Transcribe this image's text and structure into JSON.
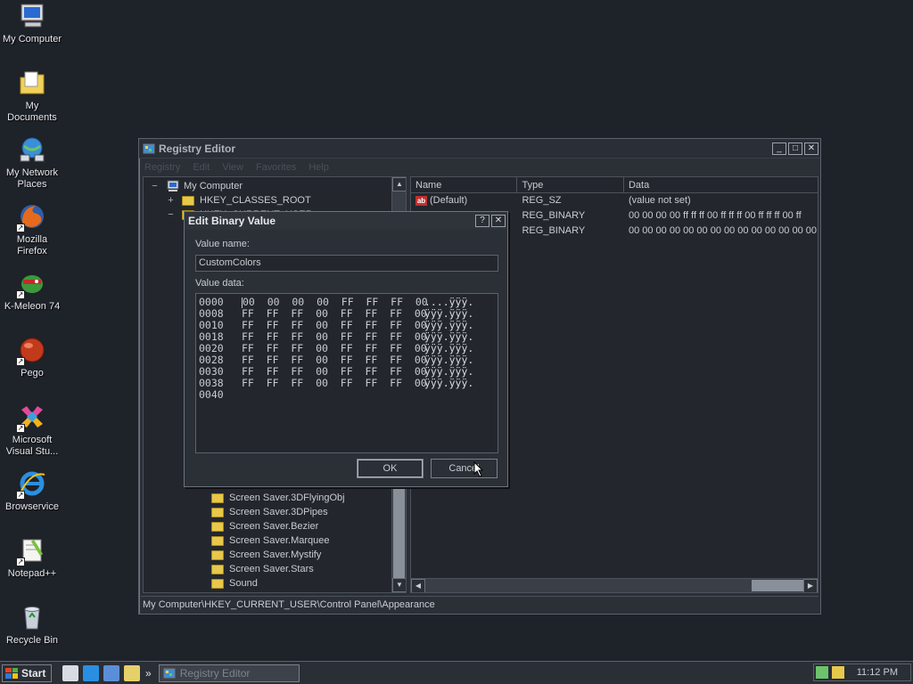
{
  "desktop": {
    "icons": [
      {
        "label": "My Computer",
        "icon": "computer-icon"
      },
      {
        "label": "My Documents",
        "icon": "documents-folder-icon"
      },
      {
        "label": "My Network Places",
        "icon": "network-icon"
      },
      {
        "label": "Mozilla Firefox",
        "icon": "firefox-icon"
      },
      {
        "label": "K-Meleon 74",
        "icon": "k-meleon-icon"
      },
      {
        "label": "Pego",
        "icon": "pego-icon"
      },
      {
        "label": "Microsoft Visual Stu...",
        "icon": "visual-studio-icon"
      },
      {
        "label": "Browservice",
        "icon": "internet-explorer-icon"
      },
      {
        "label": "Notepad++",
        "icon": "notepad-plus-icon"
      },
      {
        "label": "Recycle Bin",
        "icon": "recycle-bin-icon"
      }
    ]
  },
  "regedit": {
    "title": "Registry Editor",
    "controls": {
      "minimize": "_",
      "maximize": "□",
      "close": "✕"
    },
    "menu": [
      "Registry",
      "Edit",
      "View",
      "Favorites",
      "Help"
    ],
    "tree": {
      "root": "My Computer",
      "hkcr": "HKEY_CLASSES_ROOT",
      "hkcu": "HKEY_CURRENT_USER",
      "items": [
        "Screen Saver.3DFlyingObj",
        "Screen Saver.3DPipes",
        "Screen Saver.Bezier",
        "Screen Saver.Marquee",
        "Screen Saver.Mystify",
        "Screen Saver.Stars",
        "Sound"
      ]
    },
    "columns": {
      "name": "Name",
      "type": "Type",
      "data": "Data"
    },
    "values": [
      {
        "name": "(Default)",
        "type": "REG_SZ",
        "data": "(value not set)"
      },
      {
        "name": "",
        "type": "REG_BINARY",
        "data": "00 00 00 00 ff ff ff 00 ff ff ff 00 ff ff ff 00 ff"
      },
      {
        "name": "",
        "type": "REG_BINARY",
        "data": "00 00 00 00 00 00 00 00 00 00 00 00 00 00 00 00 00"
      }
    ],
    "status": "My Computer\\HKEY_CURRENT_USER\\Control Panel\\Appearance"
  },
  "dialog": {
    "title": "Edit Binary Value",
    "help": "?",
    "close": "✕",
    "value_name_label": "Value name:",
    "value_name": "CustomColors",
    "value_data_label": "Value data:",
    "rows": [
      {
        "offset": "0000",
        "bytes": "00  00  00  00  FF  FF  FF  00",
        "ascii": " ....ÿÿÿ."
      },
      {
        "offset": "0008",
        "bytes": "FF  FF  FF  00  FF  FF  FF  00",
        "ascii": " ÿÿÿ.ÿÿÿ."
      },
      {
        "offset": "0010",
        "bytes": "FF  FF  FF  00  FF  FF  FF  00",
        "ascii": " ÿÿÿ.ÿÿÿ."
      },
      {
        "offset": "0018",
        "bytes": "FF  FF  FF  00  FF  FF  FF  00",
        "ascii": " ÿÿÿ.ÿÿÿ."
      },
      {
        "offset": "0020",
        "bytes": "FF  FF  FF  00  FF  FF  FF  00",
        "ascii": " ÿÿÿ.ÿÿÿ."
      },
      {
        "offset": "0028",
        "bytes": "FF  FF  FF  00  FF  FF  FF  00",
        "ascii": " ÿÿÿ.ÿÿÿ."
      },
      {
        "offset": "0030",
        "bytes": "FF  FF  FF  00  FF  FF  FF  00",
        "ascii": " ÿÿÿ.ÿÿÿ."
      },
      {
        "offset": "0038",
        "bytes": "FF  FF  FF  00  FF  FF  FF  00",
        "ascii": " ÿÿÿ.ÿÿÿ."
      },
      {
        "offset": "0040",
        "bytes": "",
        "ascii": ""
      }
    ],
    "ok": "OK",
    "cancel": "Cancel"
  },
  "taskbar": {
    "start": "Start",
    "chevron": "»",
    "task": "Registry Editor",
    "clock": "11:12 PM"
  }
}
